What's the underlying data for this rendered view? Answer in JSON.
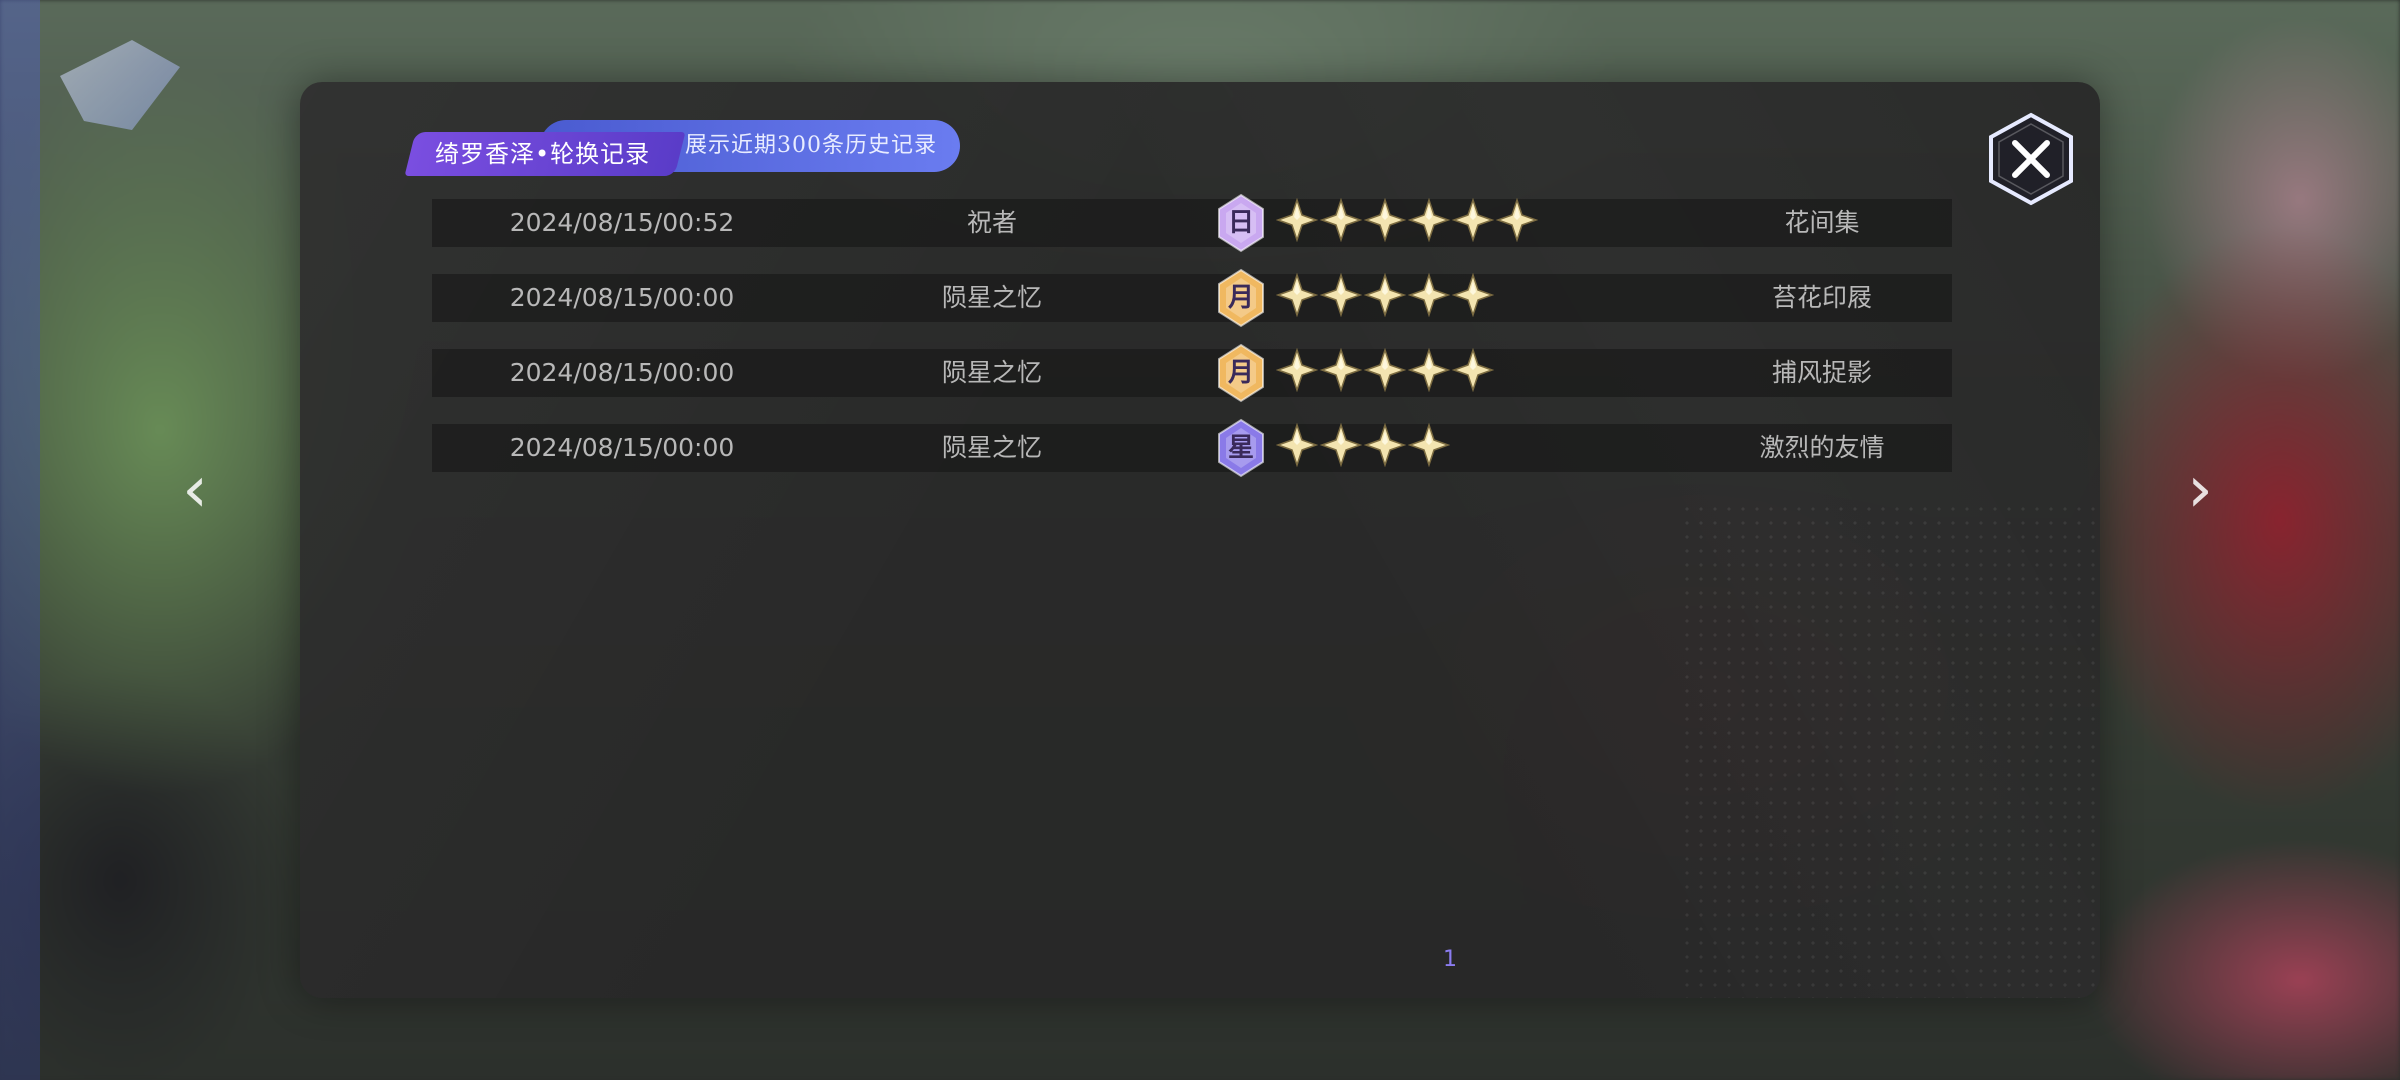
{
  "header": {
    "title": "绮罗香泽•轮换记录",
    "subtitle": "展示近期300条历史记录"
  },
  "table": {
    "rows": [
      {
        "time": "2024/08/15/00:52",
        "pool": "祝者",
        "badge": "日",
        "badge_color": "#c9a8f0",
        "stars": 6,
        "name": "花间集"
      },
      {
        "time": "2024/08/15/00:00",
        "pool": "陨星之忆",
        "badge": "月",
        "badge_color": "#f0b860",
        "stars": 5,
        "name": "苔花印屐"
      },
      {
        "time": "2024/08/15/00:00",
        "pool": "陨星之忆",
        "badge": "月",
        "badge_color": "#f0b860",
        "stars": 5,
        "name": "捕风捉影"
      },
      {
        "time": "2024/08/15/00:00",
        "pool": "陨星之忆",
        "badge": "星",
        "badge_color": "#8a7ae8",
        "stars": 4,
        "name": "激烈的友情"
      }
    ]
  },
  "pagination": {
    "page": "1"
  },
  "colors": {
    "accent_purple": "#7a4ee0",
    "accent_blue": "#4a5bd0",
    "star_gold": "#f3e4b0",
    "page_number": "#8b7cf0"
  },
  "icons": {
    "close": "close-x-icon",
    "prev": "chevron-left-icon",
    "next": "chevron-right-icon",
    "star": "four-point-star-icon"
  }
}
